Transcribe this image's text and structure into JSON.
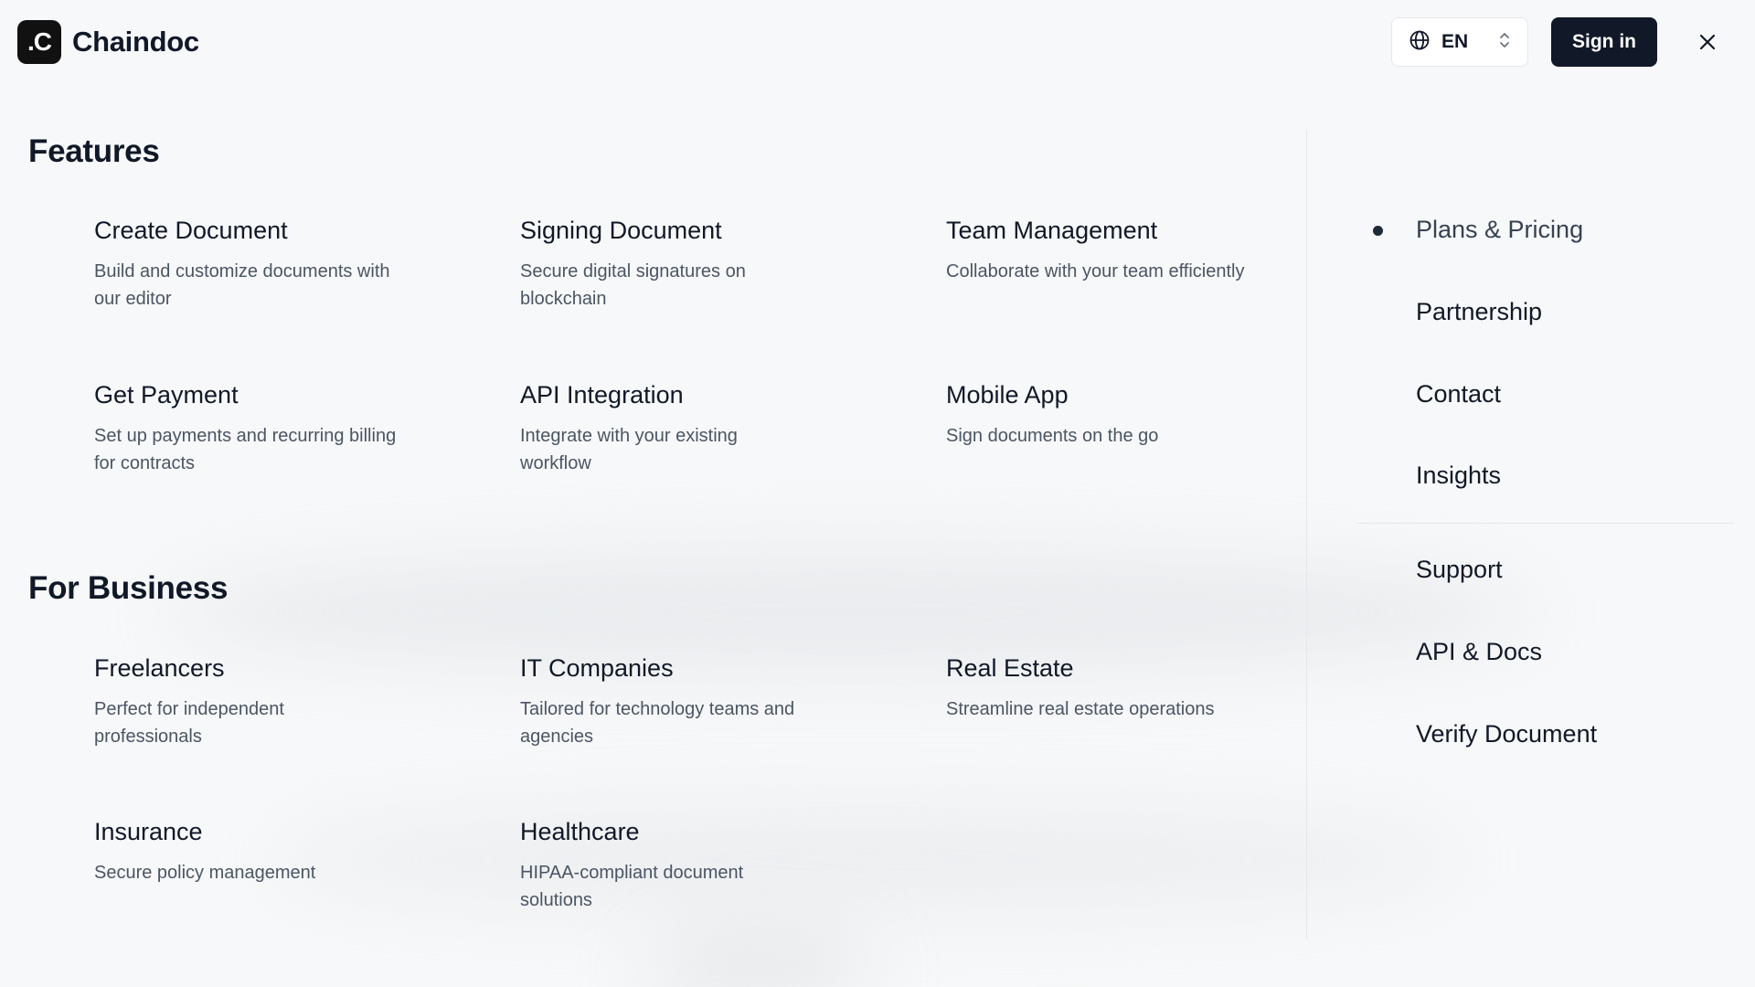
{
  "brand": {
    "name": "Chaindoc",
    "logo_mark": ".C"
  },
  "header": {
    "language": "EN",
    "sign_in_label": "Sign in"
  },
  "features": {
    "title": "Features",
    "items": [
      {
        "title": "Create Document",
        "desc": "Build and customize documents with our editor"
      },
      {
        "title": "Signing Document",
        "desc": "Secure digital signatures on blockchain"
      },
      {
        "title": "Team Management",
        "desc": "Collaborate with your team efficiently"
      },
      {
        "title": "Get Payment",
        "desc": "Set up payments and recurring billing for contracts"
      },
      {
        "title": "API Integration",
        "desc": "Integrate with your existing workflow"
      },
      {
        "title": "Mobile App",
        "desc": "Sign documents on the go"
      }
    ]
  },
  "business": {
    "title": "For Business",
    "items": [
      {
        "title": "Freelancers",
        "desc": "Perfect for independent professionals"
      },
      {
        "title": "IT Companies",
        "desc": "Tailored for technology teams and agencies"
      },
      {
        "title": "Real Estate",
        "desc": "Streamline real estate operations"
      },
      {
        "title": "Insurance",
        "desc": "Secure policy management"
      },
      {
        "title": "Healthcare",
        "desc": "HIPAA-compliant document solutions"
      }
    ]
  },
  "side_nav": {
    "primary": [
      "Plans & Pricing",
      "Partnership",
      "Contact",
      "Insights"
    ],
    "secondary": [
      "Support",
      "API & Docs",
      "Verify Document"
    ],
    "active": "Plans & Pricing"
  },
  "colors": {
    "background": "#f7f8f9",
    "primary_dark": "#111827",
    "text_muted": "#4b5563",
    "border": "#e5e7eb"
  },
  "icons": {
    "language": "globe-icon",
    "language_toggle": "chevron-up-down-icon",
    "close": "close-icon"
  }
}
